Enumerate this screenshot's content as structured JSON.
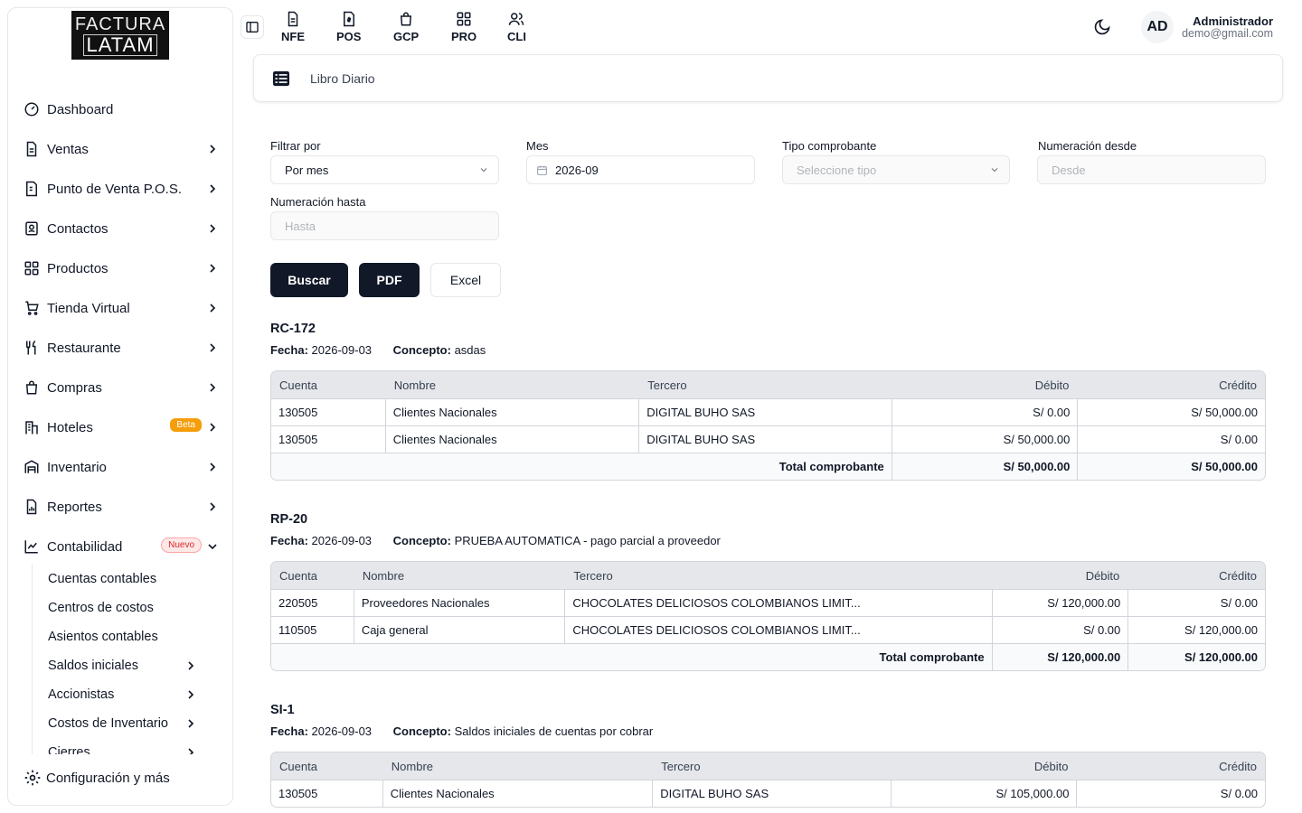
{
  "logo": {
    "line1": "FACTURA",
    "line2": "LATAM"
  },
  "sidebar": {
    "items": [
      {
        "label": "Dashboard",
        "icon": "gauge-icon",
        "chevron": false
      },
      {
        "label": "Ventas",
        "icon": "document-icon",
        "chevron": true
      },
      {
        "label": "Punto de Venta P.O.S.",
        "icon": "receipt-icon",
        "chevron": true
      },
      {
        "label": "Contactos",
        "icon": "contacts-icon",
        "chevron": true
      },
      {
        "label": "Productos",
        "icon": "grid-icon",
        "chevron": true
      },
      {
        "label": "Tienda Virtual",
        "icon": "cart-icon",
        "chevron": true
      },
      {
        "label": "Restaurante",
        "icon": "utensils-icon",
        "chevron": true
      },
      {
        "label": "Compras",
        "icon": "bag-icon",
        "chevron": true
      },
      {
        "label": "Hoteles",
        "icon": "hotel-icon",
        "chevron": true,
        "badge": "Beta"
      },
      {
        "label": "Inventario",
        "icon": "warehouse-icon",
        "chevron": true
      },
      {
        "label": "Reportes",
        "icon": "report-icon",
        "chevron": true
      },
      {
        "label": "Contabilidad",
        "icon": "chart-icon",
        "chevron": "down",
        "badge": "Nuevo"
      }
    ],
    "submenu": [
      {
        "label": "Cuentas contables",
        "chevron": false
      },
      {
        "label": "Centros de costos",
        "chevron": false
      },
      {
        "label": "Asientos contables",
        "chevron": false
      },
      {
        "label": "Saldos iniciales",
        "chevron": true
      },
      {
        "label": "Accionistas",
        "chevron": true
      },
      {
        "label": "Costos de Inventario",
        "chevron": true
      },
      {
        "label": "Cierres",
        "chevron": true
      }
    ],
    "config_label": "Configuración y más"
  },
  "topbar": {
    "modules": [
      {
        "label": "NFE",
        "icon": "file-text-icon"
      },
      {
        "label": "POS",
        "icon": "receipt-dollar-icon"
      },
      {
        "label": "GCP",
        "icon": "shopping-bag-icon"
      },
      {
        "label": "PRO",
        "icon": "grid-icon"
      },
      {
        "label": "CLI",
        "icon": "users-icon"
      }
    ],
    "avatar_initials": "AD",
    "user_name": "Administrador",
    "user_email": "demo@gmail.com"
  },
  "page": {
    "title": "Libro Diario"
  },
  "filters": {
    "filtrar_label": "Filtrar por",
    "filtrar_value": "Por mes",
    "mes_label": "Mes",
    "mes_value": "2026-09",
    "tipo_label": "Tipo comprobante",
    "tipo_placeholder": "Seleccione tipo",
    "desde_label": "Numeración desde",
    "desde_placeholder": "Desde",
    "hasta_label": "Numeración hasta",
    "hasta_placeholder": "Hasta"
  },
  "buttons": {
    "buscar": "Buscar",
    "pdf": "PDF",
    "excel": "Excel"
  },
  "labels": {
    "fecha": "Fecha:",
    "concepto": "Concepto:",
    "total": "Total comprobante"
  },
  "columns": {
    "cuenta": "Cuenta",
    "nombre": "Nombre",
    "tercero": "Tercero",
    "debito": "Débito",
    "credito": "Crédito"
  },
  "entries": [
    {
      "code": "RC-172",
      "fecha": "2026-09-03",
      "concepto": "asdas",
      "rows": [
        {
          "cuenta": "130505",
          "nombre": "Clientes Nacionales",
          "tercero": "DIGITAL BUHO SAS",
          "debito": "S/ 0.00",
          "credito": "S/ 50,000.00"
        },
        {
          "cuenta": "130505",
          "nombre": "Clientes Nacionales",
          "tercero": "DIGITAL BUHO SAS",
          "debito": "S/ 50,000.00",
          "credito": "S/ 0.00"
        }
      ],
      "total_debito": "S/ 50,000.00",
      "total_credito": "S/ 50,000.00"
    },
    {
      "code": "RP-20",
      "fecha": "2026-09-03",
      "concepto": "PRUEBA AUTOMATICA - pago parcial a proveedor",
      "rows": [
        {
          "cuenta": "220505",
          "nombre": "Proveedores Nacionales",
          "tercero": "CHOCOLATES DELICIOSOS COLOMBIANOS LIMIT...",
          "debito": "S/ 120,000.00",
          "credito": "S/ 0.00"
        },
        {
          "cuenta": "110505",
          "nombre": "Caja general",
          "tercero": "CHOCOLATES DELICIOSOS COLOMBIANOS LIMIT...",
          "debito": "S/ 0.00",
          "credito": "S/ 120,000.00"
        }
      ],
      "total_debito": "S/ 120,000.00",
      "total_credito": "S/ 120,000.00"
    },
    {
      "code": "SI-1",
      "fecha": "2026-09-03",
      "concepto": "Saldos iniciales de cuentas por cobrar",
      "rows": [
        {
          "cuenta": "130505",
          "nombre": "Clientes Nacionales",
          "tercero": "DIGITAL BUHO SAS",
          "debito": "S/ 105,000.00",
          "credito": "S/ 0.00"
        }
      ]
    }
  ]
}
